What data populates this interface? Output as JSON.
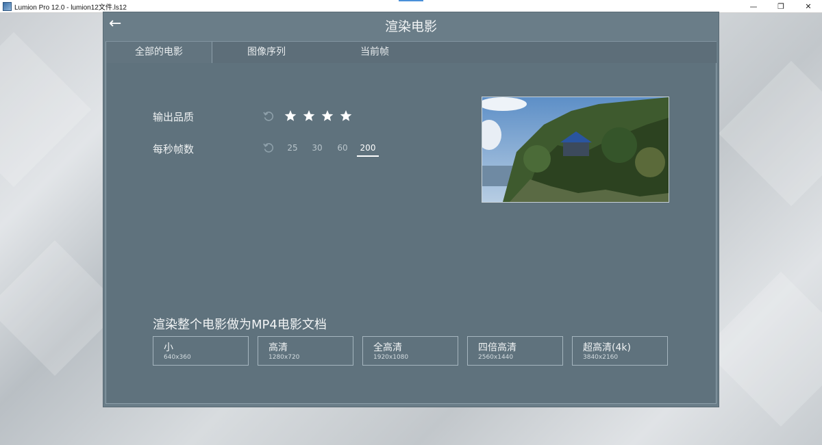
{
  "window": {
    "title": "Lumion Pro 12.0  - lumion12文件.ls12",
    "minimize_glyph": "—",
    "maximize_glyph": "❐",
    "close_glyph": "✕"
  },
  "panel": {
    "title": "渲染电影",
    "back_glyph": "←"
  },
  "tabs": [
    {
      "label": "全部的电影",
      "active": true
    },
    {
      "label": "图像序列",
      "active": false
    },
    {
      "label": "当前帧",
      "active": false
    }
  ],
  "settings": {
    "quality_label": "输出品质",
    "quality_stars": 4,
    "fps_label": "每秒帧数",
    "fps_options": [
      "25",
      "30",
      "60",
      "200"
    ],
    "fps_selected": "200"
  },
  "export": {
    "title": "渲染整个电影做为MP4电影文档",
    "options": [
      {
        "name": "小",
        "dim": "640x360"
      },
      {
        "name": "高清",
        "dim": "1280x720"
      },
      {
        "name": "全高清",
        "dim": "1920x1080"
      },
      {
        "name": "四倍高清",
        "dim": "2560x1440"
      },
      {
        "name": "超高清(4k)",
        "dim": "3840x2160"
      }
    ]
  },
  "colors": {
    "panel_bg": "#6a7d88",
    "content_bg": "#5f727d",
    "accent_text": "#ffffff"
  },
  "icons": [
    "back-arrow-icon",
    "reset-icon",
    "star-icon",
    "app-icon"
  ]
}
